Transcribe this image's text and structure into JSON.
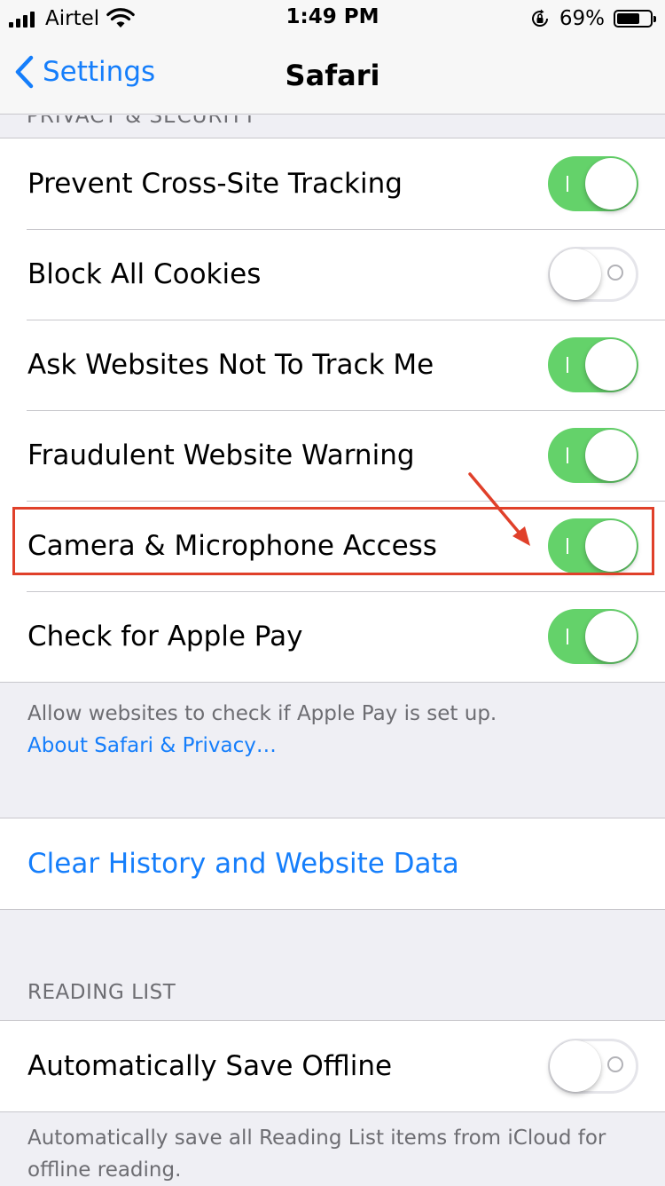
{
  "status_bar": {
    "carrier": "Airtel",
    "time": "1:49 PM",
    "battery_percent": "69%",
    "battery_level": 0.69
  },
  "nav": {
    "back_label": "Settings",
    "title": "Safari"
  },
  "privacy_section": {
    "header": "PRIVACY & SECURITY",
    "rows": [
      {
        "label": "Prevent Cross-Site Tracking",
        "on": true
      },
      {
        "label": "Block All Cookies",
        "on": false
      },
      {
        "label": "Ask Websites Not To Track Me",
        "on": true
      },
      {
        "label": "Fraudulent Website Warning",
        "on": true
      },
      {
        "label": "Camera & Microphone Access",
        "on": true
      },
      {
        "label": "Check for Apple Pay",
        "on": true
      }
    ],
    "footer": "Allow websites to check if Apple Pay is set up.",
    "footer_link": "About Safari & Privacy…"
  },
  "clear_history": {
    "label": "Clear History and Website Data"
  },
  "reading_list": {
    "header": "READING LIST",
    "rows": [
      {
        "label": "Automatically Save Offline",
        "on": false
      }
    ],
    "footer": "Automatically save all Reading List items from iCloud for offline reading."
  },
  "colors": {
    "accent": "#157efb",
    "toggle_on": "#64d26a",
    "annotation": "#e0402a",
    "background": "#efeff4"
  }
}
